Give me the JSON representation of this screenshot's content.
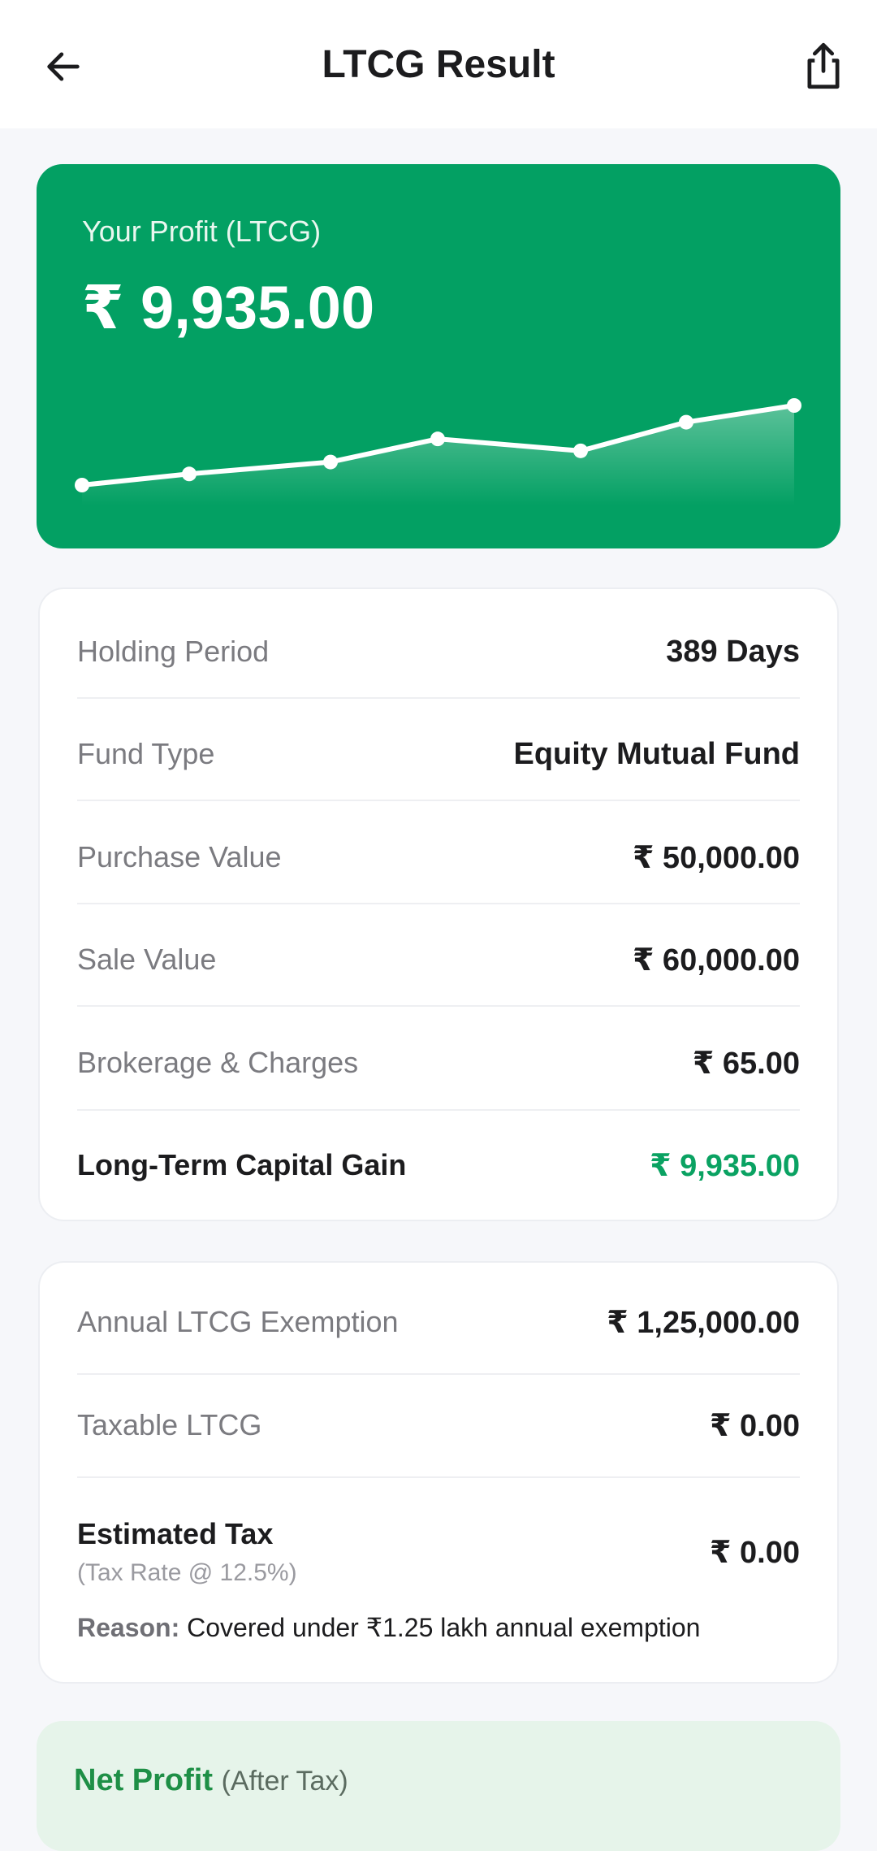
{
  "appbar": {
    "title": "LTCG Result",
    "back_icon": "arrow-left-icon",
    "share_icon": "share-icon"
  },
  "hero": {
    "label": "Your Profit (LTCG)",
    "value": "₹ 9,935.00",
    "background": "#03a063",
    "sparkline": [
      0.0,
      0.14,
      0.29,
      0.58,
      0.43,
      0.79,
      1.0
    ]
  },
  "details": {
    "rows": [
      {
        "label": "Holding Period",
        "value": "389 Days"
      },
      {
        "label": "Fund Type",
        "value": "Equity Mutual Fund"
      },
      {
        "label": "Purchase Value",
        "value": "₹ 50,000.00"
      },
      {
        "label": "Sale Value",
        "value": "₹ 60,000.00"
      },
      {
        "label": "Brokerage & Charges",
        "value": "₹ 65.00"
      },
      {
        "label": "Long-Term Capital Gain",
        "value": "₹ 9,935.00"
      }
    ]
  },
  "tax": {
    "exemption_label": "Annual LTCG Exemption",
    "exemption_value": "₹ 1,25,000.00",
    "taxable_label": "Taxable LTCG",
    "taxable_value": "₹ 0.00",
    "estimated_label": "Estimated Tax",
    "estimated_rate": "(Tax Rate @ 12.5%)",
    "estimated_value": "₹ 0.00",
    "reason_key": "Reason:",
    "reason_text": "Covered under ₹1.25 lakh annual exemption"
  },
  "net": {
    "title": "Net Profit",
    "paren": "(After Tax)"
  },
  "colors": {
    "accent_green": "#03a063",
    "gain_green": "#0aa262",
    "net_bg": "#e6f4ea"
  }
}
